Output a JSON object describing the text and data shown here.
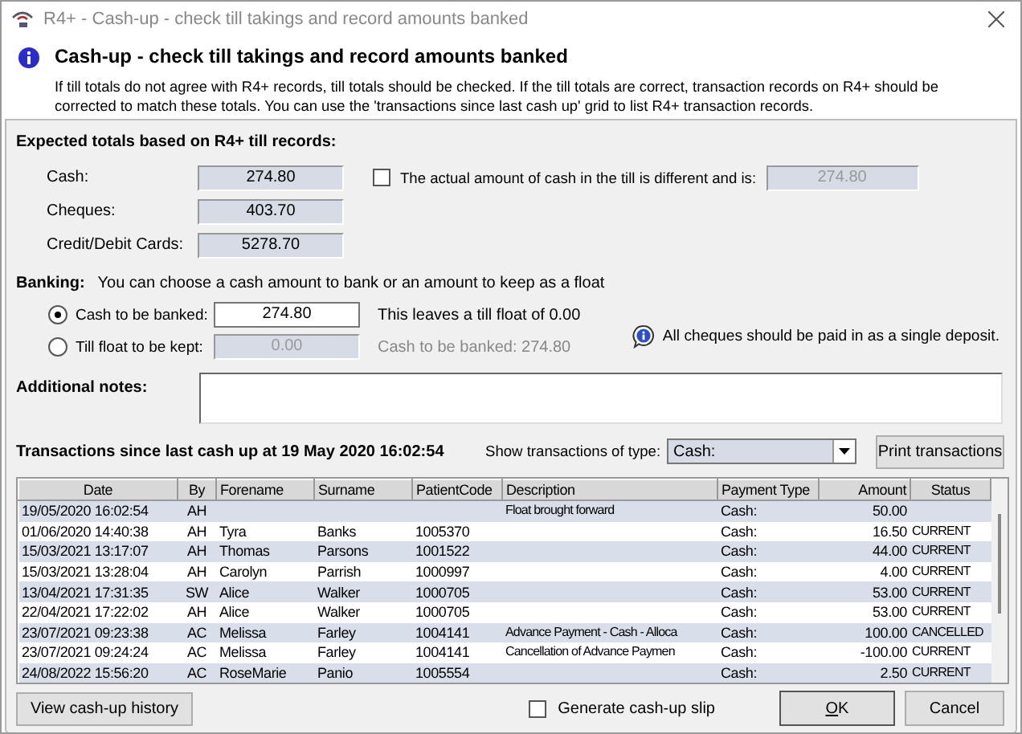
{
  "window": {
    "title": "R4+ - Cash-up - check till takings and record amounts banked"
  },
  "header": {
    "title": "Cash-up - check till takings and record amounts banked",
    "message": "If till totals do not agree with R4+ records, till totals should be checked.  If the till totals are correct, transaction records on R4+ should be corrected to match these totals.  You can use the 'transactions since last cash up' grid to list R4+ transaction records."
  },
  "expected_totals": {
    "heading": "Expected totals based on R4+ till records:",
    "rows": [
      {
        "label": "Cash:",
        "value": "274.80"
      },
      {
        "label": "Cheques:",
        "value": "403.70"
      },
      {
        "label": "Credit/Debit Cards:",
        "value": "5278.70"
      }
    ],
    "actual_cash": {
      "label": "The actual amount of cash in the till is different and is:",
      "checked": false,
      "value": "274.80"
    }
  },
  "banking": {
    "heading": "Banking:",
    "hint": "You can choose a cash amount to bank or an amount to keep as a float",
    "options": [
      {
        "label": "Cash to be banked:",
        "selected": true,
        "value": "274.80",
        "note": "This leaves a till float of 0.00"
      },
      {
        "label": "Till float to be kept:",
        "selected": false,
        "value": "0.00",
        "note": "Cash to be banked: 274.80"
      }
    ],
    "info_note": "All cheques should be paid in as a single deposit."
  },
  "notes": {
    "label": "Additional notes:"
  },
  "transactions": {
    "heading": "Transactions since last cash up at 19 May 2020 16:02:54",
    "filter_label": "Show transactions of type:",
    "filter_value": "Cash:",
    "print_button": "Print transactions",
    "columns": [
      "Date",
      "By",
      "Forename",
      "Surname",
      "PatientCode",
      "Description",
      "Payment Type",
      "Amount",
      "Status"
    ],
    "rows": [
      [
        "19/05/2020 16:02:54",
        "AH",
        "",
        "",
        "",
        "Float brought forward",
        "Cash:",
        "50.00",
        ""
      ],
      [
        "01/06/2020 14:40:38",
        "AH",
        "Tyra",
        "Banks",
        "1005370",
        "",
        "Cash:",
        "16.50",
        "CURRENT"
      ],
      [
        "15/03/2021 13:17:07",
        "AH",
        "Thomas",
        "Parsons",
        "1001522",
        "",
        "Cash:",
        "44.00",
        "CURRENT"
      ],
      [
        "15/03/2021 13:28:04",
        "AH",
        "Carolyn",
        "Parrish",
        "1000997",
        "",
        "Cash:",
        "4.00",
        "CURRENT"
      ],
      [
        "13/04/2021 17:31:35",
        "SW",
        "Alice",
        "Walker",
        "1000705",
        "",
        "Cash:",
        "53.00",
        "CURRENT"
      ],
      [
        "22/04/2021 17:22:02",
        "AH",
        "Alice",
        "Walker",
        "1000705",
        "",
        "Cash:",
        "53.00",
        "CURRENT"
      ],
      [
        "23/07/2021 09:23:38",
        "AC",
        "Melissa",
        "Farley",
        "1004141",
        "Advance Payment - Cash - Alloca",
        "Cash:",
        "100.00",
        "CANCELLED"
      ],
      [
        "23/07/2021 09:24:24",
        "AC",
        "Melissa",
        "Farley",
        "1004141",
        "Cancellation of Advance Paymen",
        "Cash:",
        "-100.00",
        "CURRENT"
      ],
      [
        "24/08/2022 15:56:20",
        "AC",
        "RoseMarie",
        "Panio",
        "1005554",
        "",
        "Cash:",
        "2.50",
        "CURRENT"
      ]
    ]
  },
  "footer": {
    "history_button": "View cash-up history",
    "slip": {
      "label": "Generate cash-up slip",
      "checked": false
    },
    "ok_button": "OK",
    "cancel_button": "Cancel"
  }
}
